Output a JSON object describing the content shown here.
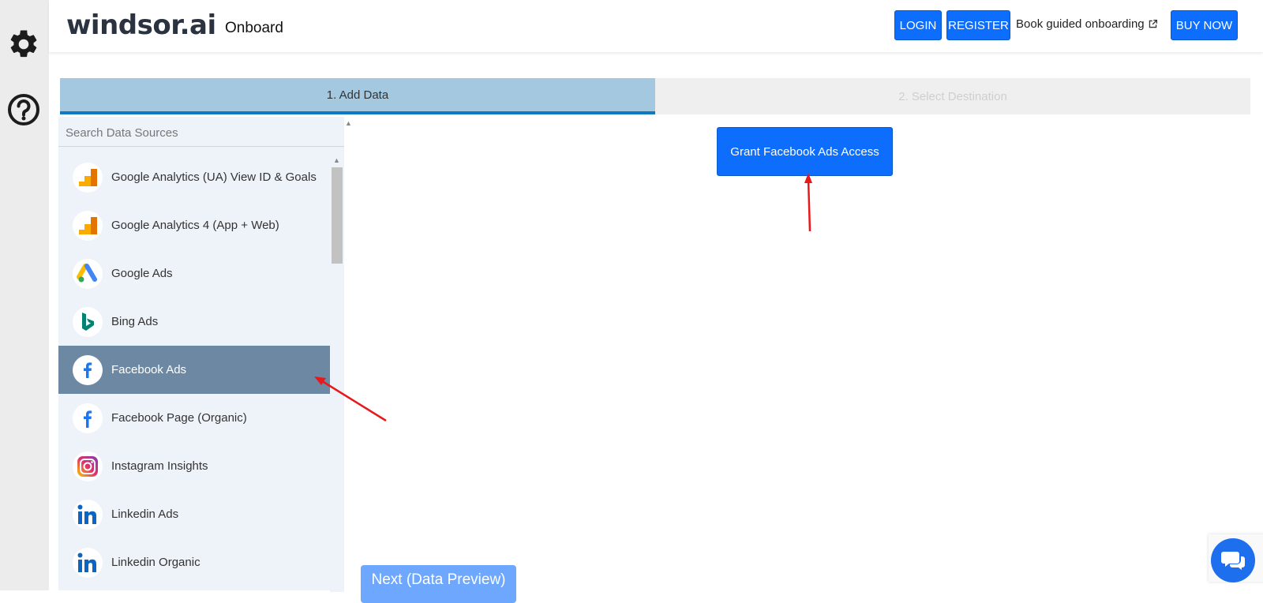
{
  "header": {
    "logo": "windsor.ai",
    "subtitle": "Onboard",
    "login_label": "LOGIN",
    "register_label": "REGISTER",
    "book_label": "Book guided onboarding",
    "buy_label": "BUY NOW"
  },
  "steps": [
    {
      "label": "1. Add Data",
      "state": "active"
    },
    {
      "label": "2. Select Destination",
      "state": "inactive"
    }
  ],
  "sidebar": {
    "search_placeholder": "Search Data Sources",
    "items": [
      {
        "label": "Google Analytics (UA) View ID & Goals",
        "icon": "google-analytics-icon"
      },
      {
        "label": "Google Analytics 4 (App + Web)",
        "icon": "google-analytics-icon"
      },
      {
        "label": "Google Ads",
        "icon": "google-ads-icon"
      },
      {
        "label": "Bing Ads",
        "icon": "bing-icon"
      },
      {
        "label": "Facebook Ads",
        "icon": "facebook-icon",
        "selected": true
      },
      {
        "label": "Facebook Page (Organic)",
        "icon": "facebook-icon"
      },
      {
        "label": "Instagram Insights",
        "icon": "instagram-icon"
      },
      {
        "label": "Linkedin Ads",
        "icon": "linkedin-icon"
      },
      {
        "label": "Linkedin Organic",
        "icon": "linkedin-icon"
      }
    ]
  },
  "main": {
    "grant_label": "Grant Facebook Ads Access",
    "next_label": "Next (Data Preview)"
  },
  "colors": {
    "primary": "#0d6efd",
    "active_item": "#6d88a3",
    "step_active": "#a3c8e0",
    "annotation": "#e8191b"
  }
}
